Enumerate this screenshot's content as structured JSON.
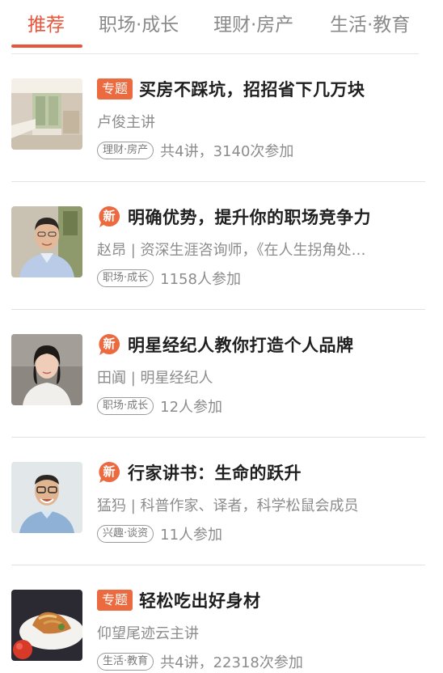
{
  "tabs": [
    {
      "label": "推荐",
      "active": true
    },
    {
      "label": "职场·成长",
      "active": false
    },
    {
      "label": "理财·房产",
      "active": false
    },
    {
      "label": "生活·教育",
      "active": false
    }
  ],
  "colors": {
    "accent": "#e8553b",
    "badge": "#ec6a3f"
  },
  "items": [
    {
      "badge": "专题",
      "title": "买房不踩坑，招招省下几万块",
      "subtitle": "卢俊主讲",
      "tag": "理财·房产",
      "meta": "共4讲，3140次参加",
      "thumb": "kitchen-interior-image"
    },
    {
      "badge": "新",
      "title": "明确优势，提升你的职场竞争力",
      "subtitle": "赵昂 | 资深生涯咨询师，《在人生拐角处…",
      "tag": "职场·成长",
      "meta": "1158人参加",
      "thumb": "speaker-portrait-image"
    },
    {
      "badge": "新",
      "title": "明星经纪人教你打造个人品牌",
      "subtitle": "田阗 | 明星经纪人",
      "tag": "职场·成长",
      "meta": "12人参加",
      "thumb": "speaker-portrait-image"
    },
    {
      "badge": "新",
      "title": "行家讲书：生命的跃升",
      "subtitle": "猛犸 | 科普作家、译者，科学松鼠会成员",
      "tag": "兴趣·谈资",
      "meta": "11人参加",
      "thumb": "speaker-portrait-image"
    },
    {
      "badge": "专题",
      "title": "轻松吃出好身材",
      "subtitle": "仰望尾迹云主讲",
      "tag": "生活·教育",
      "meta": "共4讲，22318次参加",
      "thumb": "food-plate-image"
    }
  ]
}
